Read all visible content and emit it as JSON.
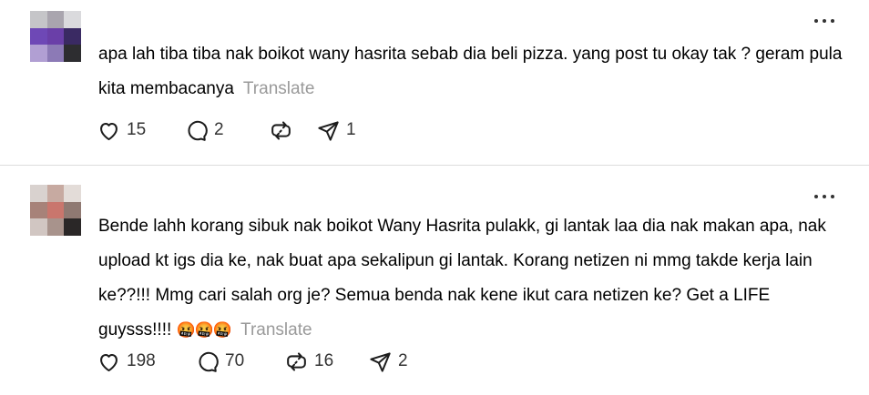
{
  "posts": [
    {
      "text": "apa lah tiba tiba nak boikot wany hasrita sebab dia beli pizza. yang post tu okay tak ? geram pula kita membacanya",
      "emoji": "",
      "translate_label": "Translate",
      "likes": "15",
      "replies": "2",
      "reposts": "",
      "shares": "1",
      "avatar_colors": [
        "#c5c5c8",
        "#a9a5ae",
        "#dadadd",
        "#6e48b6",
        "#6a3fa8",
        "#3a2a63",
        "#b19fd3",
        "#8c7ab6",
        "#2d2d30"
      ]
    },
    {
      "text": "Bende lahh korang sibuk nak boikot Wany Hasrita pulakk, gi lantak laa dia nak makan apa, nak upload kt igs dia ke, nak buat apa sekalipun gi lantak. Korang netizen ni mmg takde kerja lain ke??!!! Mmg cari salah org je? Semua benda nak kene ikut cara netizen ke? Get a LIFE guysss!!!!",
      "emoji": "🤬🤬🤬",
      "translate_label": "Translate",
      "likes": "198",
      "replies": "70",
      "reposts": "16",
      "shares": "2",
      "avatar_colors": [
        "#d9d2cf",
        "#c7aaa1",
        "#e3dcd8",
        "#a78279",
        "#c9766d",
        "#8f7972",
        "#d1c6c2",
        "#a8938c",
        "#2a2727"
      ]
    }
  ],
  "icons": {
    "more": "more-dots-icon",
    "like": "heart-icon",
    "reply": "speech-bubble-icon",
    "repost": "repost-arrows-icon",
    "share": "paper-plane-icon"
  }
}
